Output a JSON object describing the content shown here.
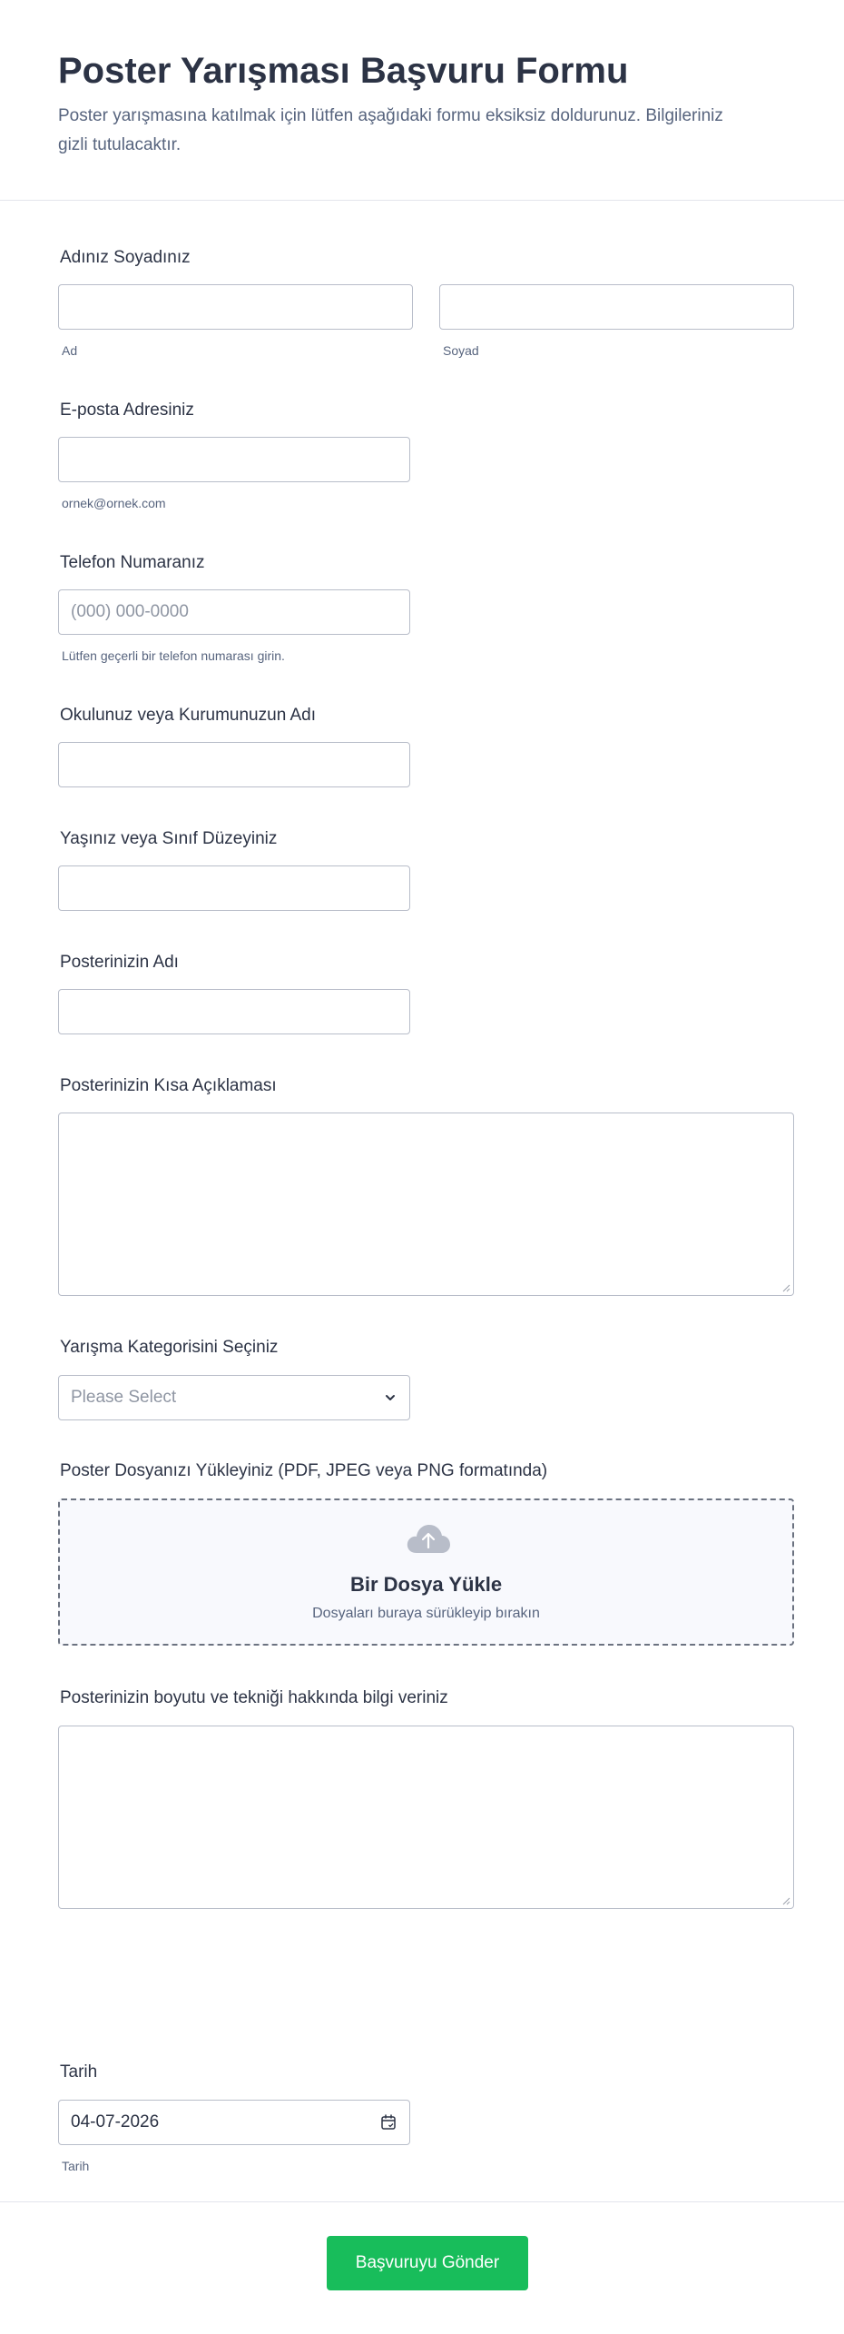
{
  "form": {
    "title": "Poster Yarışması Başvuru Formu",
    "subtitle": "Poster yarışmasına katılmak için lütfen aşağıdaki formu eksiksiz doldurunuz. Bilgileriniz gizli tutulacaktır."
  },
  "name": {
    "label": "Adınız Soyadınız",
    "first_sublabel": "Ad",
    "last_sublabel": "Soyad",
    "first_value": "",
    "last_value": ""
  },
  "email": {
    "label": "E-posta Adresiniz",
    "value": "",
    "sublabel": "ornek@ornek.com"
  },
  "phone": {
    "label": "Telefon Numaranız",
    "placeholder": "(000) 000-0000",
    "sublabel": "Lütfen geçerli bir telefon numarası girin."
  },
  "school": {
    "label": "Okulunuz veya Kurumunuzun Adı",
    "value": ""
  },
  "age": {
    "label": "Yaşınız veya Sınıf Düzeyiniz",
    "value": ""
  },
  "poster_name": {
    "label": "Posterinizin Adı",
    "value": ""
  },
  "poster_desc": {
    "label": "Posterinizin Kısa Açıklaması",
    "value": ""
  },
  "category": {
    "label": "Yarışma Kategorisini Seçiniz",
    "selected": "Please Select"
  },
  "upload": {
    "label": "Poster Dosyanızı Yükleyiniz (PDF, JPEG veya PNG formatında)",
    "title": "Bir Dosya Yükle",
    "subtitle": "Dosyaları buraya sürükleyip bırakın",
    "icon": "cloud-upload-icon"
  },
  "size_info": {
    "label": "Posterinizin boyutu ve tekniği hakkında bilgi veriniz",
    "value": ""
  },
  "date": {
    "label": "Tarih",
    "value": "04-07-2026",
    "sublabel": "Tarih",
    "icon": "calendar-icon"
  },
  "submit": {
    "label": "Başvuruyu Gönder",
    "color": "#18bd5b"
  }
}
